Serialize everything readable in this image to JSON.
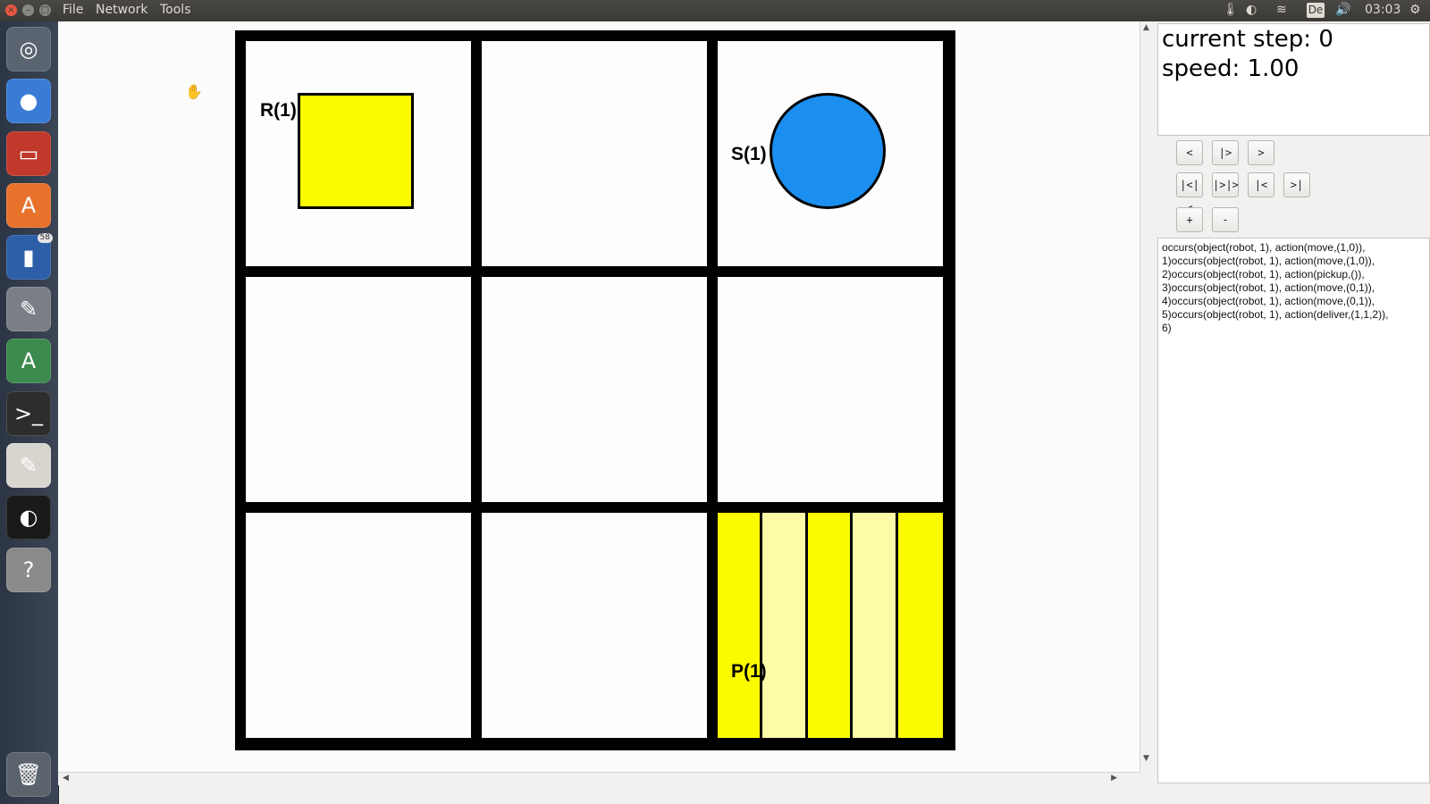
{
  "menu": {
    "file": "File",
    "network": "Network",
    "tools": "Tools"
  },
  "window_buttons": {
    "close": "×",
    "minimize": "–",
    "maximize": "□"
  },
  "tray": {
    "language": "De",
    "time": "03:03"
  },
  "launcher": {
    "items": [
      {
        "name": "ubuntu-dash",
        "glyph": "◎",
        "color": "#5a6470"
      },
      {
        "name": "chrome",
        "glyph": "●",
        "color": "#3a7bd5"
      },
      {
        "name": "files",
        "glyph": "▭",
        "color": "#c0392b"
      },
      {
        "name": "software-center",
        "glyph": "A",
        "color": "#e8722c"
      },
      {
        "name": "system-monitor",
        "glyph": "▮",
        "color": "#2c5fa8",
        "badge": "58"
      },
      {
        "name": "system-tools",
        "glyph": "✎",
        "color": "#7a7f86"
      },
      {
        "name": "software-updater",
        "glyph": "A",
        "color": "#3d8a4f"
      },
      {
        "name": "terminal",
        "glyph": ">_",
        "color": "#2d2d2d"
      },
      {
        "name": "text-editor",
        "glyph": "✎",
        "color": "#d8d5cf"
      },
      {
        "name": "obs",
        "glyph": "◐",
        "color": "#1a1a1a"
      },
      {
        "name": "help",
        "glyph": "?",
        "color": "#8a8a8a"
      }
    ],
    "trash_glyph": "🗑"
  },
  "grid": {
    "rows": 3,
    "cols": 3,
    "robot_label": "R(1)",
    "shelf_label": "S(1)",
    "pickstation_label": "P(1)",
    "robot_color": "#fbfb00",
    "shelf_color": "#1b8ff0",
    "stripe_colors": [
      "#fbfb00",
      "#fbfba8"
    ]
  },
  "info": {
    "current_step": "current step: 0",
    "speed": "speed: 1.00"
  },
  "controls": {
    "row1": [
      "<",
      "|>",
      ">"
    ],
    "row2": [
      "|<|<",
      "|>|>",
      "|<",
      ">|"
    ],
    "row3": [
      "+",
      "-"
    ]
  },
  "plan_text": "occurs(object(robot, 1), action(move,(1,0)),\n1)occurs(object(robot, 1), action(move,(1,0)),\n2)occurs(object(robot, 1), action(pickup,()),\n3)occurs(object(robot, 1), action(move,(0,1)),\n4)occurs(object(robot, 1), action(move,(0,1)),\n5)occurs(object(robot, 1), action(deliver,(1,1,2)),\n6)"
}
